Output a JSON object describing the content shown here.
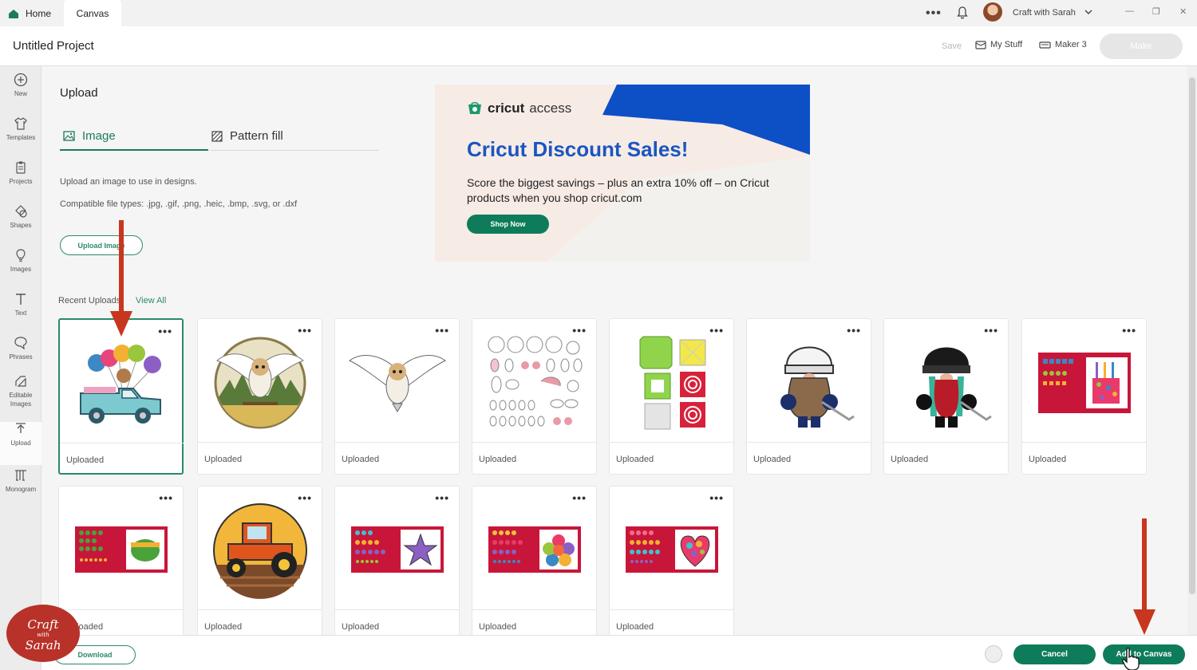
{
  "tabs": {
    "home": "Home",
    "canvas": "Canvas"
  },
  "topbar": {
    "menu": "•••",
    "username": "Craft with Sarah"
  },
  "header": {
    "title": "Untitled Project",
    "save": "Save",
    "my_stuff": "My Stuff",
    "machine": "Maker 3",
    "make": "Make"
  },
  "rail": {
    "new": "New",
    "templates": "Templates",
    "projects": "Projects",
    "shapes": "Shapes",
    "images": "Images",
    "text": "Text",
    "phrases": "Phrases",
    "editable_images": "Editable Images",
    "upload": "Upload",
    "monogram": "Monogram"
  },
  "panel": {
    "title": "Upload",
    "tab_image": "Image",
    "tab_pattern": "Pattern fill",
    "desc1": "Upload an image to use in designs.",
    "desc2": "Compatible file types: .jpg, .gif, .png, .heic, .bmp, .svg, or .dxf",
    "upload_button": "Upload Image",
    "recent": "Recent Uploads",
    "view_all": "View All"
  },
  "ad": {
    "brand_bold": "cricut",
    "brand_light": "access",
    "headline": "Cricut Discount Sales!",
    "sub": "Score the biggest savings – plus an extra 10% off – on Cricut products when you shop cricut.com",
    "button": "Shop Now"
  },
  "uploads": [
    {
      "label": "Uploaded",
      "icon": "new-baby-truck-image"
    },
    {
      "label": "Uploaded",
      "icon": "owl-circle-scene-image"
    },
    {
      "label": "Uploaded",
      "icon": "flying-owl-image"
    },
    {
      "label": "Uploaded",
      "icon": "pieces-sheet-image"
    },
    {
      "label": "Uploaded",
      "icon": "box-template-image"
    },
    {
      "label": "Uploaded",
      "icon": "hockey-gnome-white-image"
    },
    {
      "label": "Uploaded",
      "icon": "hockey-gnome-black-image"
    },
    {
      "label": "Uploaded",
      "icon": "birthday-card-image"
    },
    {
      "label": "Uploaded",
      "icon": "shamrock-card-image"
    },
    {
      "label": "Uploaded",
      "icon": "tractor-image"
    },
    {
      "label": "Uploaded",
      "icon": "star-card-image"
    },
    {
      "label": "Uploaded",
      "icon": "flower-card-image"
    },
    {
      "label": "Uploaded",
      "icon": "heart-card-image"
    }
  ],
  "footer": {
    "download": "Download",
    "cancel": "Cancel",
    "add_to_canvas": "Add to Canvas"
  },
  "watermark": {
    "line1": "Craft",
    "line2": "with",
    "line3": "Sarah"
  },
  "colors": {
    "accent": "#0e7c5a",
    "ad_blue": "#1a56c0",
    "annotation_red": "#c8361f"
  }
}
